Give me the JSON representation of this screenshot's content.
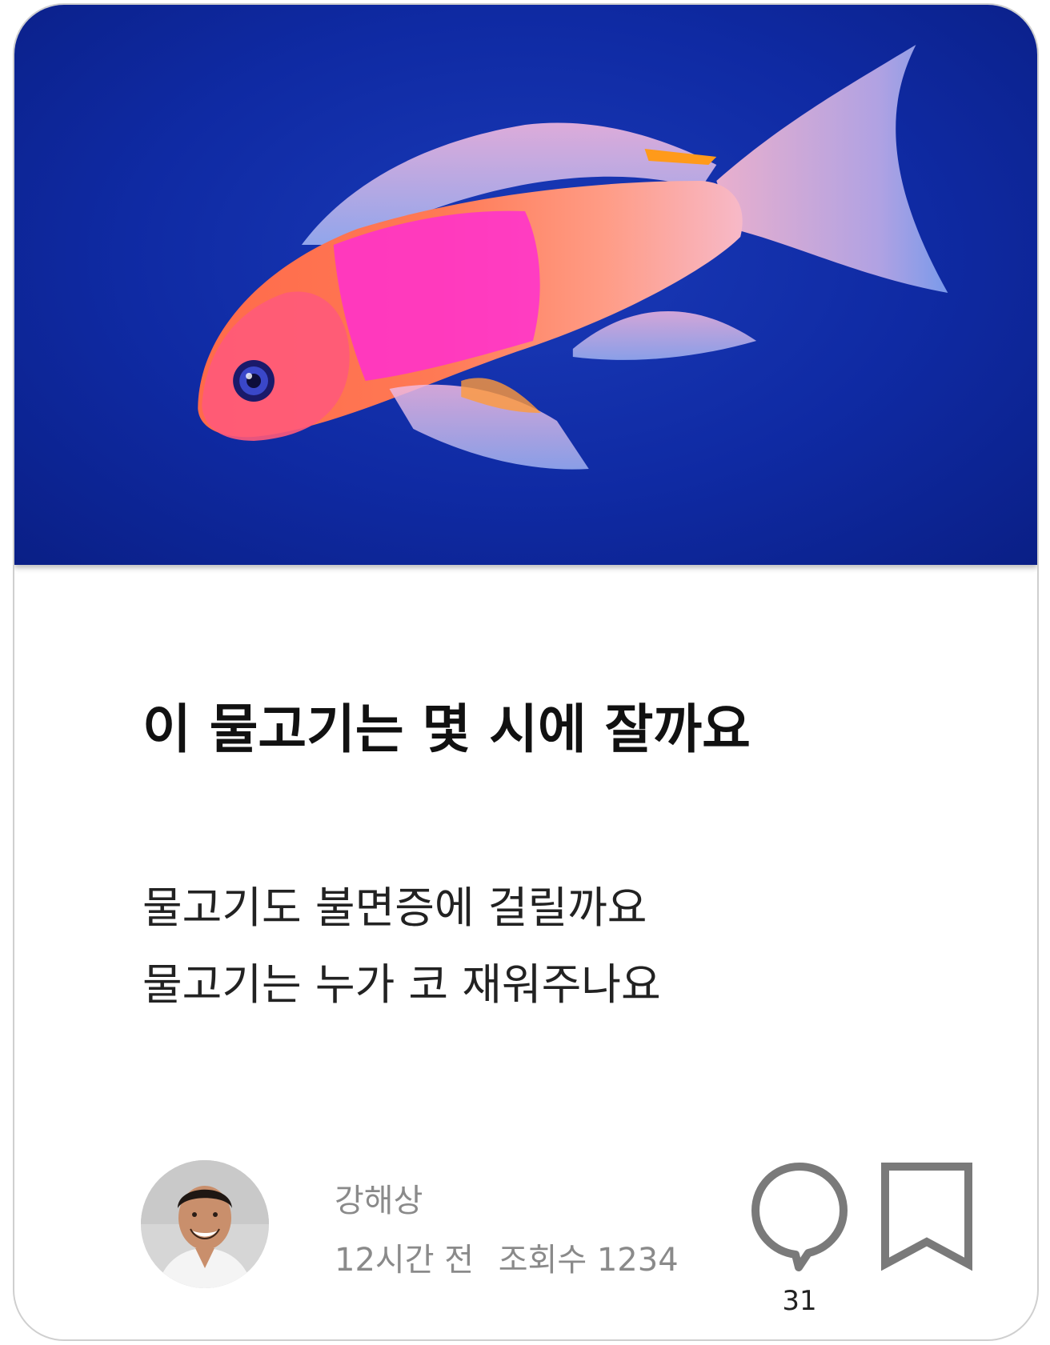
{
  "post": {
    "title": "이 물고기는 몇 시에 잘까요",
    "body_lines": [
      "물고기도 불면증에 걸릴까요",
      "물고기는 누가 코 재워주나요"
    ],
    "author": "강해상",
    "time_ago": "12시간 전",
    "views": "조회수 1234",
    "comment_count": "31"
  },
  "icons": {
    "comment": "speech-bubble-icon",
    "bookmark": "bookmark-icon"
  },
  "colors": {
    "hero_background": "#0f2aa3",
    "icon": "#7a7a7a",
    "meta_text": "#8a8a8a"
  }
}
